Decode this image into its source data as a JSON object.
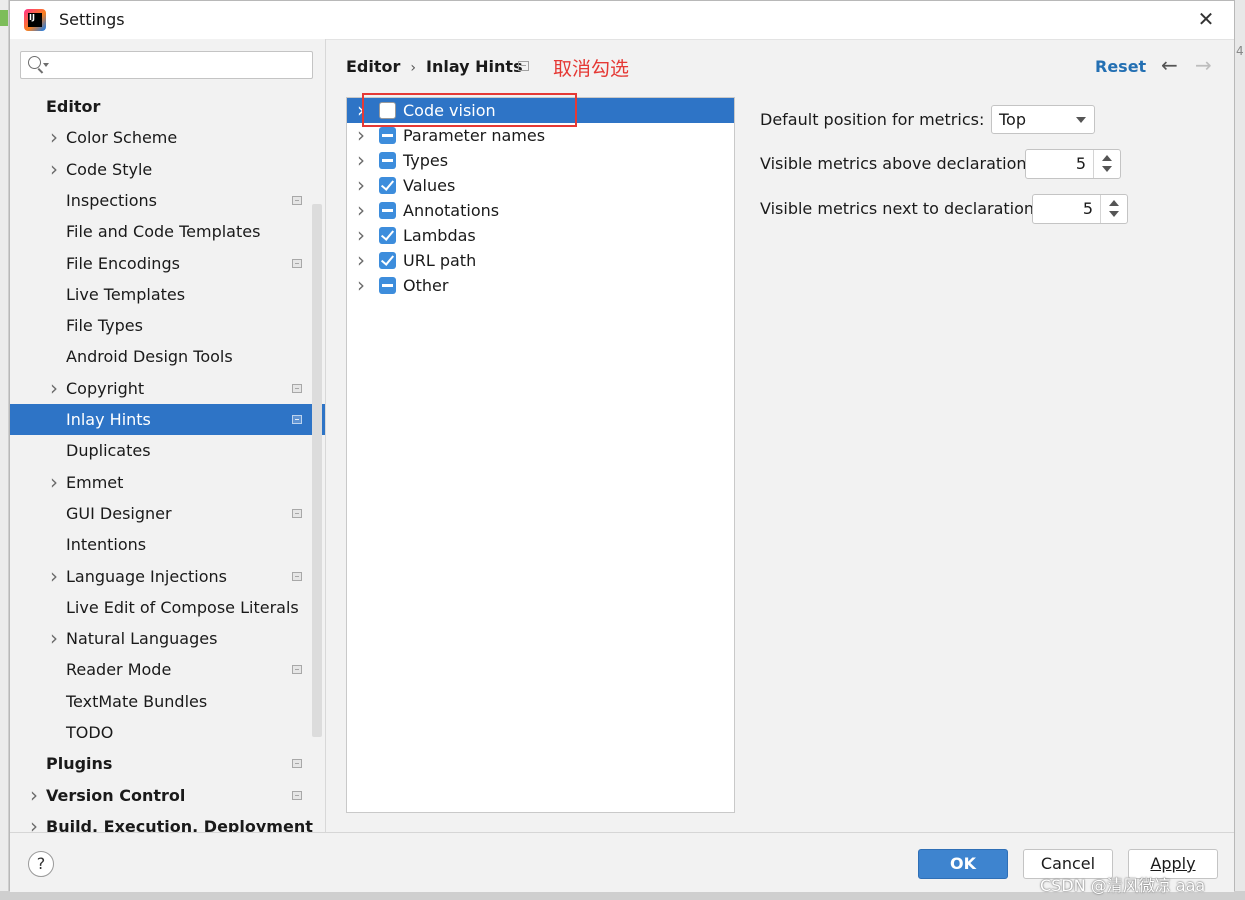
{
  "window": {
    "title": "Settings",
    "close_glyph": "✕"
  },
  "search": {
    "placeholder": ""
  },
  "sidebar": {
    "items": [
      {
        "label": "Editor",
        "level": 0,
        "expandable": false
      },
      {
        "label": "Color Scheme",
        "level": 1,
        "expandable": true
      },
      {
        "label": "Code Style",
        "level": 1,
        "expandable": true
      },
      {
        "label": "Inspections",
        "level": 1,
        "project": true
      },
      {
        "label": "File and Code Templates",
        "level": 1
      },
      {
        "label": "File Encodings",
        "level": 1,
        "project": true
      },
      {
        "label": "Live Templates",
        "level": 1
      },
      {
        "label": "File Types",
        "level": 1
      },
      {
        "label": "Android Design Tools",
        "level": 1
      },
      {
        "label": "Copyright",
        "level": 1,
        "expandable": true,
        "project": true
      },
      {
        "label": "Inlay Hints",
        "level": 1,
        "project": true,
        "selected": true
      },
      {
        "label": "Duplicates",
        "level": 1
      },
      {
        "label": "Emmet",
        "level": 1,
        "expandable": true
      },
      {
        "label": "GUI Designer",
        "level": 1,
        "project": true
      },
      {
        "label": "Intentions",
        "level": 1
      },
      {
        "label": "Language Injections",
        "level": 1,
        "expandable": true,
        "project": true
      },
      {
        "label": "Live Edit of Compose Literals",
        "level": 1
      },
      {
        "label": "Natural Languages",
        "level": 1,
        "expandable": true
      },
      {
        "label": "Reader Mode",
        "level": 1,
        "project": true
      },
      {
        "label": "TextMate Bundles",
        "level": 1
      },
      {
        "label": "TODO",
        "level": 1
      },
      {
        "label": "Plugins",
        "level": 0,
        "project": true
      },
      {
        "label": "Version Control",
        "level": 0,
        "expandable": true,
        "project": true
      },
      {
        "label": "Build, Execution, Deployment",
        "level": 0,
        "expandable": true
      }
    ]
  },
  "breadcrumb": {
    "parent": "Editor",
    "separator": "›",
    "current": "Inlay Hints"
  },
  "annotation": "取消勾选",
  "toolbar": {
    "reset_label": "Reset",
    "back_glyph": "←",
    "forward_glyph": "→"
  },
  "hints": [
    {
      "label": "Code vision",
      "state": "unchecked",
      "selected": true
    },
    {
      "label": "Parameter names",
      "state": "indeterminate"
    },
    {
      "label": "Types",
      "state": "indeterminate"
    },
    {
      "label": "Values",
      "state": "checked"
    },
    {
      "label": "Annotations",
      "state": "indeterminate"
    },
    {
      "label": "Lambdas",
      "state": "checked"
    },
    {
      "label": "URL path",
      "state": "checked"
    },
    {
      "label": "Other",
      "state": "indeterminate"
    }
  ],
  "settings": {
    "default_position_label": "Default position for metrics:",
    "default_position_value": "Top",
    "above_label": "Visible metrics above declaration:",
    "above_value": "5",
    "next_label": "Visible metrics next to declaration:",
    "next_value": "5"
  },
  "footer": {
    "help_glyph": "?",
    "ok_label": "OK",
    "cancel_label": "Cancel",
    "apply_label": "Apply"
  },
  "watermark": "CSDN @清风微凉 aaa",
  "edge_text": "4",
  "colors": {
    "accent": "#2e74c6",
    "checkbox": "#3d8ddc",
    "annotation": "#e53935",
    "link": "#2470b3"
  }
}
